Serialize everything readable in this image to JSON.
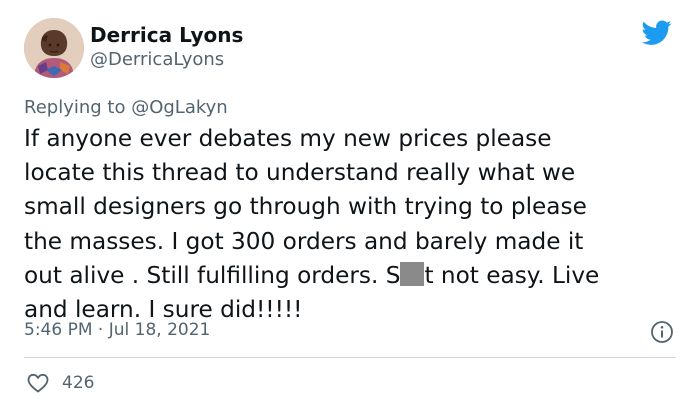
{
  "author": {
    "display_name": "Derrica Lyons",
    "handle": "@DerricaLyons",
    "avatar_icon": "profile-photo"
  },
  "brand": {
    "icon": "twitter-bird-icon",
    "color": "#1d9bf0"
  },
  "reply": {
    "prefix": "Replying to ",
    "mention": "@OgLakyn"
  },
  "tweet": {
    "lines": [
      "If anyone ever debates my new prices please",
      "locate this thread to understand really what we",
      "small designers go through with trying to please",
      "the masses. I got 300 orders and barely made it",
      "out alive . Still fulfilling orders. S",
      "t not easy. Live",
      "and learn. I sure did!!!!!"
    ],
    "censored": true
  },
  "meta": {
    "timestamp": "5:46 PM · Jul 18, 2021",
    "info_icon": "info-icon"
  },
  "actions": {
    "like_icon": "heart-icon",
    "like_count": "426"
  },
  "colors": {
    "text": "#0f1419",
    "secondary": "#536471",
    "divider": "#cfd9de",
    "censor": "#8a8a8a"
  }
}
